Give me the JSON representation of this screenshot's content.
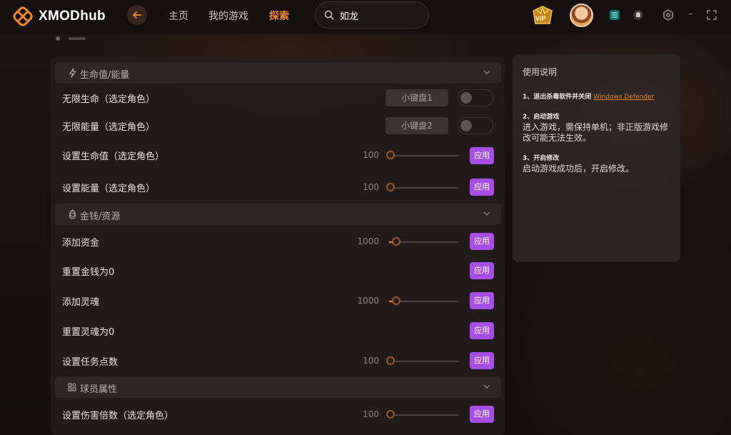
{
  "app": {
    "name": "XMODhub"
  },
  "nav": {
    "home": "主页",
    "my_games": "我的游戏",
    "explore": "探索"
  },
  "search": {
    "value": "如龙"
  },
  "vip": {
    "badge": "VIP"
  },
  "sections": [
    {
      "title": "生命值/能量",
      "icon": "lightning-icon",
      "rows": [
        {
          "label": "无限生命（选定角色）",
          "type": "toggle",
          "hotkey": "小键盘1",
          "on": false
        },
        {
          "label": "无限能量（选定角色）",
          "type": "toggle",
          "hotkey": "小键盘2",
          "on": false
        },
        {
          "label": "设置生命值（选定角色）",
          "type": "slider",
          "value": "100",
          "button": "应用"
        },
        {
          "label": "设置能量（选定角色）",
          "type": "slider",
          "value": "100",
          "button": "应用"
        }
      ]
    },
    {
      "title": "金钱/资源",
      "icon": "money-bag-icon",
      "rows": [
        {
          "label": "添加资金",
          "type": "slider",
          "value": "1000",
          "button": "应用"
        },
        {
          "label": "重置金钱为0",
          "type": "button",
          "button": "应用"
        },
        {
          "label": "添加灵魂",
          "type": "slider",
          "value": "1000",
          "button": "应用"
        },
        {
          "label": "重置灵魂为0",
          "type": "button",
          "button": "应用"
        },
        {
          "label": "设置任务点数",
          "type": "slider",
          "value": "100",
          "button": "应用"
        }
      ]
    },
    {
      "title": "球员属性",
      "icon": "attributes-icon",
      "rows": [
        {
          "label": "设置伤害倍数（选定角色）",
          "type": "slider",
          "value": "100",
          "button": "应用"
        }
      ]
    }
  ],
  "instructions": {
    "title": "使用说明",
    "step1_head": "1、退出杀毒软件并关闭",
    "step1_link": "Windows Defender",
    "step2_head": "2、启动游戏",
    "step2_body": "进入游戏，需保持单机；非正版游戏修改可能无法生效。",
    "step3_head": "3、开启修改",
    "step3_body": "启动游戏成功后，开启修改。"
  },
  "colors": {
    "accent": "#f28a2c",
    "apply": "#a64ee6",
    "panel": "#211d1c"
  }
}
